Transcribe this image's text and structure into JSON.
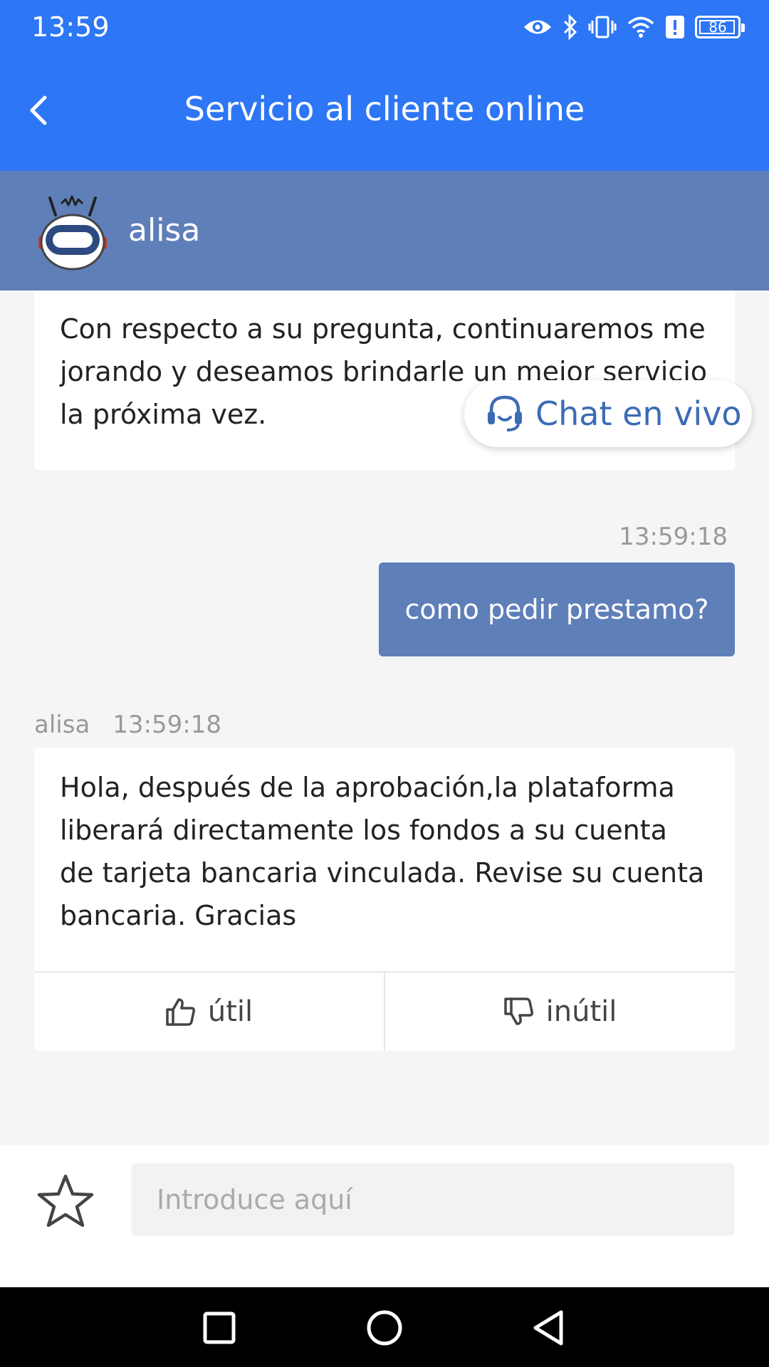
{
  "status_bar": {
    "time": "13:59",
    "battery": "86",
    "icons": [
      "eye-icon",
      "bluetooth-icon",
      "vibrate-icon",
      "wifi-icon",
      "alert-icon",
      "battery-icon"
    ]
  },
  "header": {
    "title": "Servicio al cliente online"
  },
  "agent": {
    "name": "alisa"
  },
  "messages": {
    "first_text": "Con respecto a su pregunta, continuaremos me jorando y deseamos brindarle un mejor servicio  la próxima vez.",
    "user_time": "13:59:18",
    "user_text": "como pedir prestamo?",
    "reply_sender": "alisa",
    "reply_time": "13:59:18",
    "reply_text": "Hola, después de la aprobación,la plataforma liberará directamente los fondos a su cuenta de tarjeta bancaria vinculada. Revise su cuenta bancaria. Gracias",
    "useful_label": "útil",
    "useless_label": "inútil"
  },
  "live_chat": {
    "label": "Chat en vivo"
  },
  "input": {
    "placeholder": "Introduce aquí",
    "value": ""
  },
  "colors": {
    "primary": "#2d76f5",
    "agent_bar": "#5f7fb9",
    "user_bubble": "#5f7fb9"
  }
}
